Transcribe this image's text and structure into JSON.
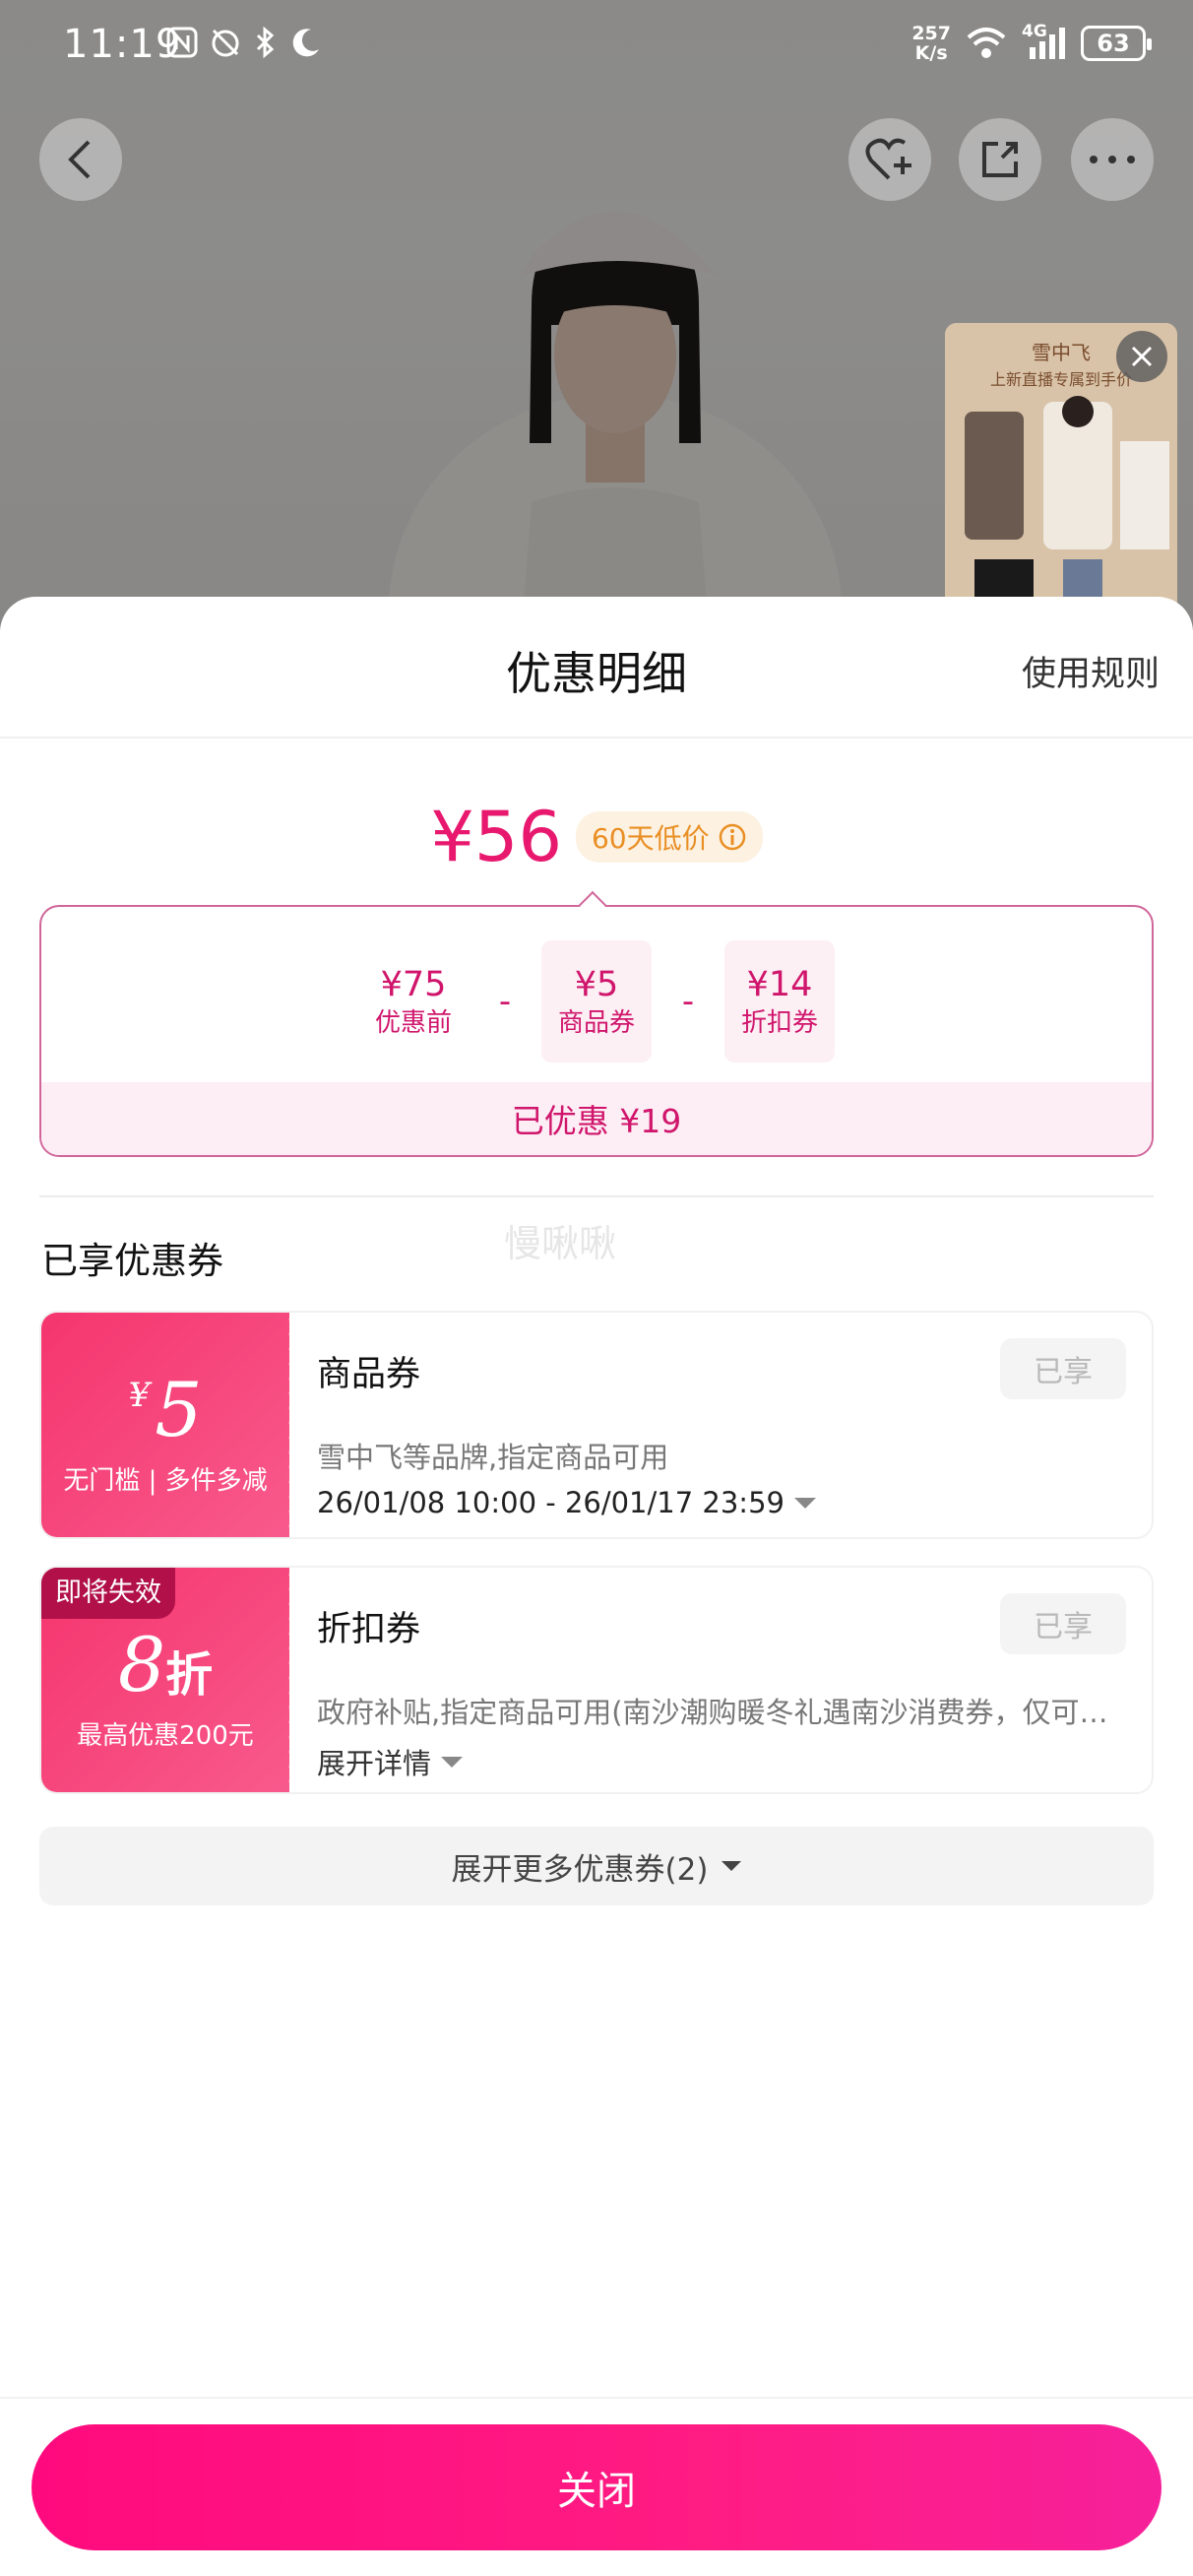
{
  "status_bar": {
    "time": "11:19",
    "net_speed_value": "257",
    "net_speed_unit": "K/s",
    "network": "4G",
    "battery": "63"
  },
  "background": {
    "live_title": "雪中飞",
    "live_subtitle": "上新直播专属到手价"
  },
  "sheet": {
    "title": "优惠明细",
    "rules_link": "使用规则",
    "final_price": "¥56",
    "low_price_badge": "60天低价",
    "calc": {
      "items": [
        {
          "value": "¥75",
          "label": "优惠前"
        },
        {
          "value": "¥5",
          "label": "商品券"
        },
        {
          "value": "¥14",
          "label": "折扣券"
        }
      ],
      "operator": "-",
      "saved": "已优惠 ¥19"
    },
    "watermark": "慢啾啾",
    "section_title": "已享优惠券",
    "coupons": [
      {
        "symbol": "¥",
        "amount": "5",
        "condition": "无门槛 | 多件多减",
        "name": "商品券",
        "desc": "雪中飞等品牌,指定商品可用",
        "time": "26/01/08 10:00 - 26/01/17 23:59",
        "status": "已享"
      },
      {
        "expire_tag": "即将失效",
        "amount": "8",
        "unit": "折",
        "condition": "最高优惠200元",
        "name": "折扣券",
        "desc": "政府补贴,指定商品可用(南沙潮购暖冬礼遇南沙消费券，仅可…",
        "expand": "展开详情",
        "status": "已享"
      }
    ],
    "more_coupons": "展开更多优惠券(2)",
    "close_button": "关闭"
  },
  "colors": {
    "accent": "#e8186e",
    "button": "#ff0a7e",
    "badge_bg": "#fdf1e2",
    "badge_text": "#e98f24"
  }
}
